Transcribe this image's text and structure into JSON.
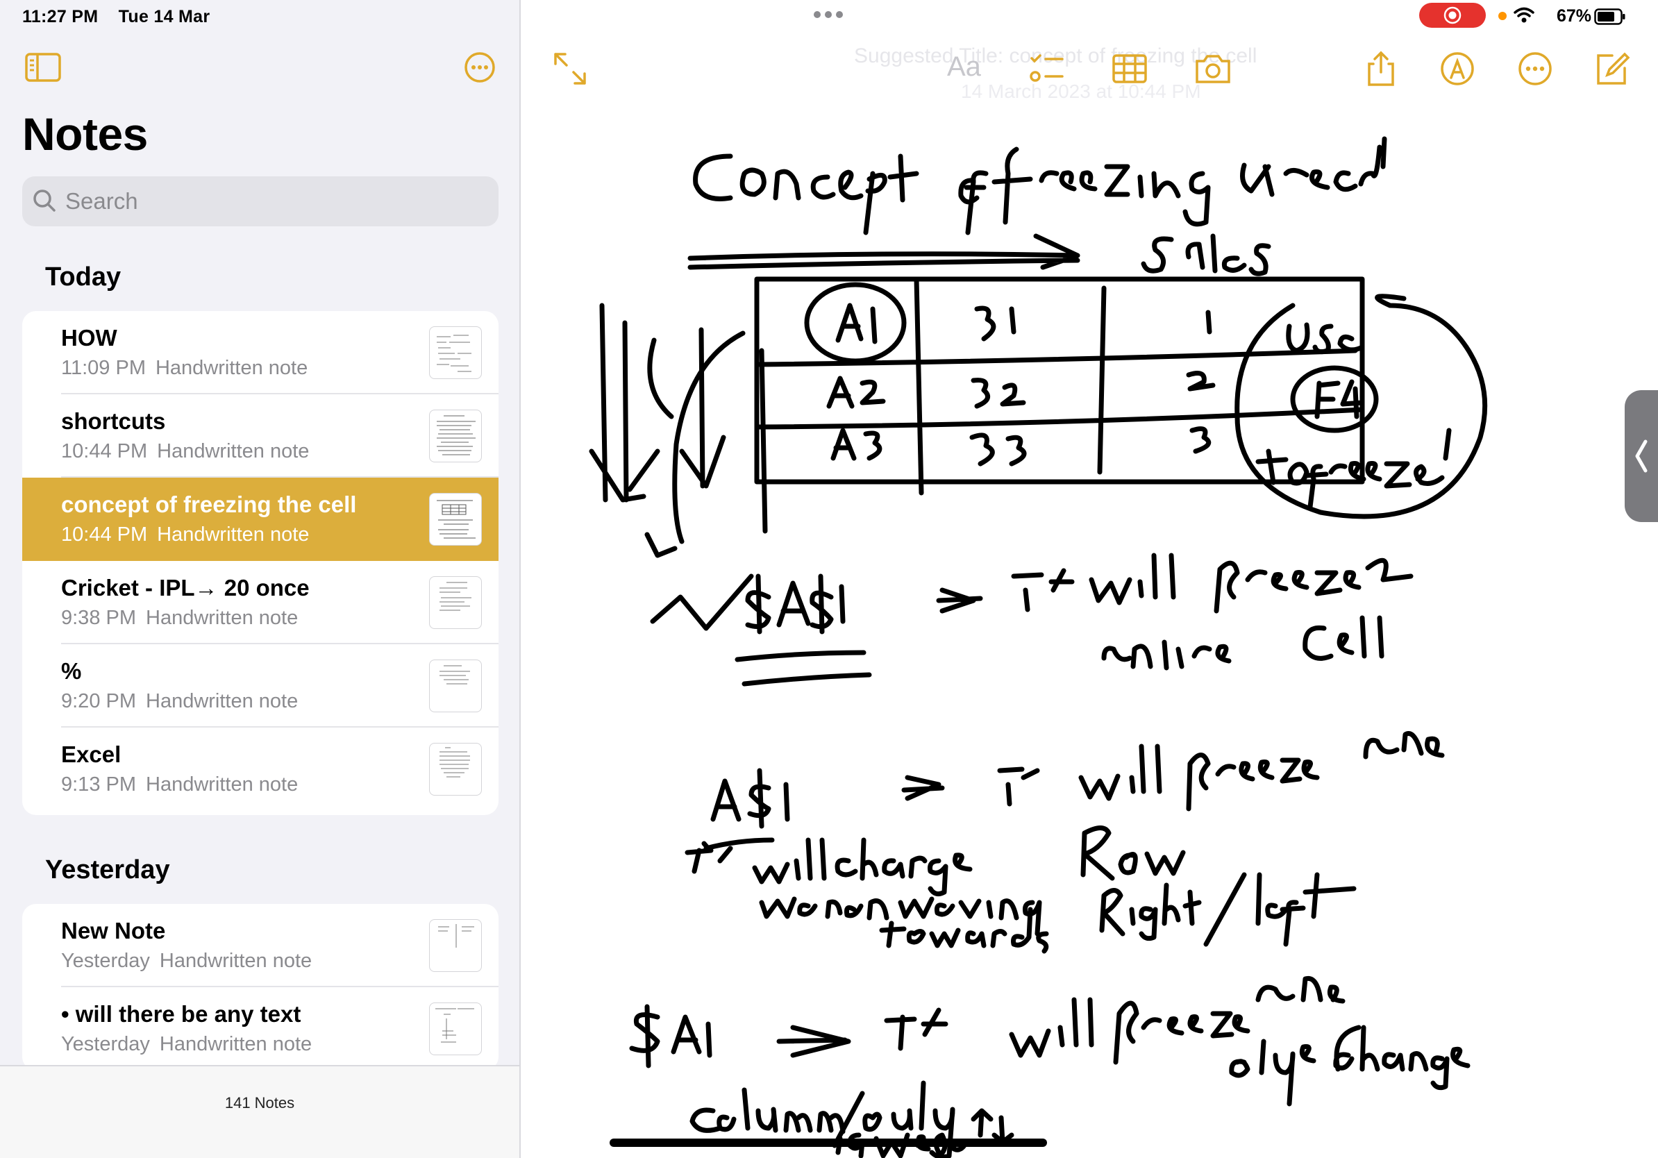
{
  "status_bar": {
    "time": "11:27 PM",
    "date": "Tue 14 Mar",
    "battery": "67%"
  },
  "sidebar": {
    "title": "Notes",
    "search_placeholder": "Search",
    "sections": [
      {
        "label": "Today",
        "notes": [
          {
            "title": "HOW",
            "time": "11:09 PM",
            "type": "Handwritten note"
          },
          {
            "title": "shortcuts",
            "time": "10:44 PM",
            "type": "Handwritten note"
          },
          {
            "title": "concept of freezing the cell",
            "time": "10:44 PM",
            "type": "Handwritten note",
            "selected": true
          },
          {
            "title": "Cricket - IPL→ 20 once",
            "time": "9:38 PM",
            "type": "Handwritten note"
          },
          {
            "title": "%",
            "time": "9:20 PM",
            "type": "Handwritten note"
          },
          {
            "title": "Excel",
            "time": "9:13 PM",
            "type": "Handwritten note"
          }
        ]
      },
      {
        "label": "Yesterday",
        "notes": [
          {
            "title": "New Note",
            "time": "Yesterday",
            "type": "Handwritten note"
          },
          {
            "title": "• will there be any text",
            "time": "Yesterday",
            "type": "Handwritten note"
          }
        ]
      }
    ],
    "footer_count": "141 Notes"
  },
  "toolbar": {
    "format_label": "Aa",
    "suggested_title": "Suggested Title: concept of freezing the cell",
    "note_date": "14 March 2023 at 10:44 PM"
  },
  "note_handwriting": {
    "heading": "Concept of freezing the cell",
    "table_label": "Sales",
    "table": [
      [
        "A1",
        "B1",
        "1"
      ],
      [
        "A2",
        "B2",
        "2"
      ],
      [
        "A3",
        "B3",
        "3"
      ]
    ],
    "side_note": "Use F4 to freeze",
    "line1": "$A$1 → It will freeze the entire cell",
    "line2": "A$1 → It will freeze the",
    "line2b": "It will change Row when moving towards Right/left",
    "line3": "$A1 → It will freeze the Column / only change if we go ↑↓"
  },
  "colors": {
    "accent": "#dcae3c",
    "toolbar_icon": "#e0a92a",
    "record": "#e5322d"
  }
}
